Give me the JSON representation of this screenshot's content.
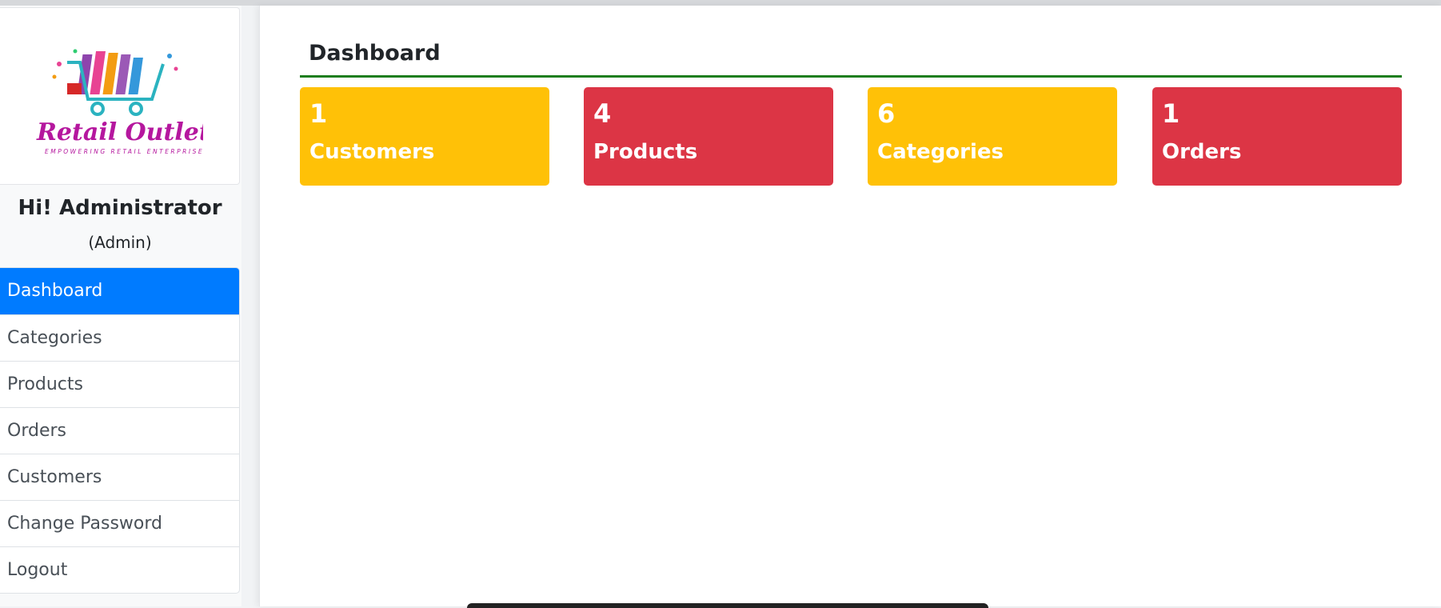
{
  "sidebar": {
    "logo": {
      "brand_text": "Retail Outlet",
      "tagline": "EMPOWERING RETAIL ENTERPRISE",
      "icon": "shopping-cart-icon"
    },
    "greeting": "Hi! Administrator",
    "role": "(Admin)",
    "nav": [
      {
        "label": "Dashboard",
        "active": true
      },
      {
        "label": "Categories",
        "active": false
      },
      {
        "label": "Products",
        "active": false
      },
      {
        "label": "Orders",
        "active": false
      },
      {
        "label": "Customers",
        "active": false
      },
      {
        "label": "Change Password",
        "active": false
      },
      {
        "label": "Logout",
        "active": false
      }
    ]
  },
  "main": {
    "title": "Dashboard",
    "cards": [
      {
        "count": "1",
        "label": "Customers",
        "color": "#ffc107"
      },
      {
        "count": "4",
        "label": "Products",
        "color": "#dc3545"
      },
      {
        "count": "6",
        "label": "Categories",
        "color": "#ffc107"
      },
      {
        "count": "1",
        "label": "Orders",
        "color": "#dc3545"
      }
    ]
  },
  "colors": {
    "active_nav": "#007bff",
    "title_rule": "#1e7e1e",
    "warning": "#ffc107",
    "danger": "#dc3545"
  }
}
